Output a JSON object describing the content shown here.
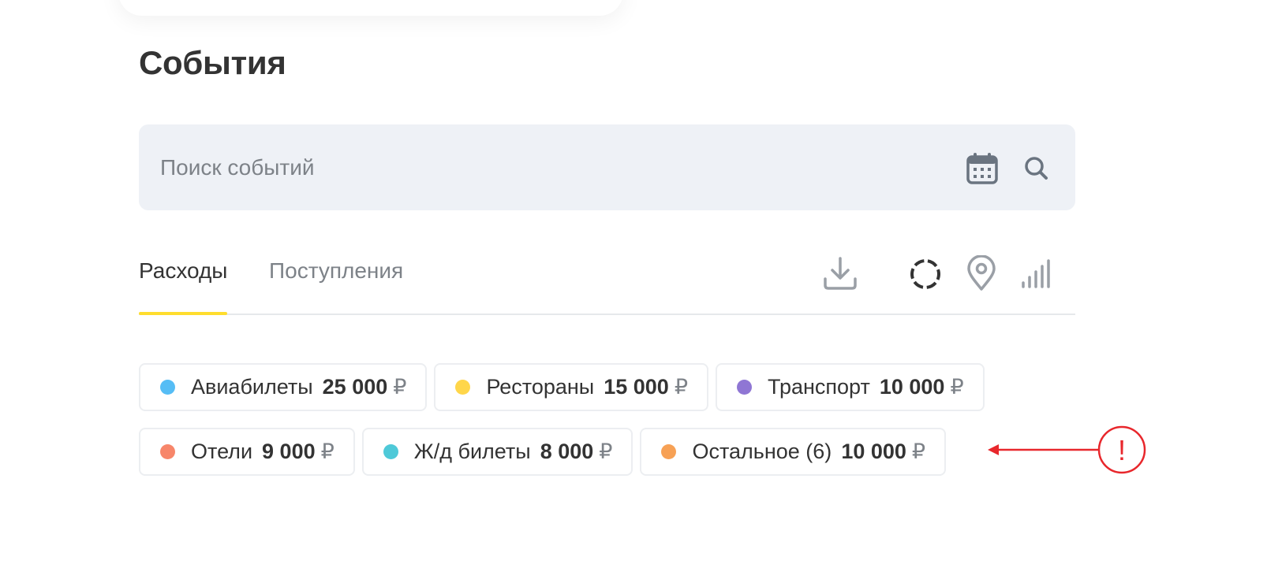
{
  "page": {
    "title": "События"
  },
  "search": {
    "placeholder": "Поиск событий",
    "value": ""
  },
  "icons": {
    "calendar": "calendar-icon",
    "search": "search-icon",
    "download": "download-icon",
    "donut": "donut-chart-icon",
    "map": "map-pin-icon",
    "bars": "bar-chart-icon",
    "annotation": "exclamation-icon"
  },
  "tabs": [
    {
      "label": "Расходы",
      "active": true
    },
    {
      "label": "Поступления",
      "active": false
    }
  ],
  "categories": [
    {
      "label": "Авиабилеты",
      "amount": "25 000",
      "currency": "₽",
      "color": "#56bdf5"
    },
    {
      "label": "Рестораны",
      "amount": "15 000",
      "currency": "₽",
      "color": "#ffd64a"
    },
    {
      "label": "Транспорт",
      "amount": "10 000",
      "currency": "₽",
      "color": "#8f76d4"
    },
    {
      "label": "Отели",
      "amount": "9 000",
      "currency": "₽",
      "color": "#f7866a"
    },
    {
      "label": "Ж/д билеты",
      "amount": "8 000",
      "currency": "₽",
      "color": "#4ec9d8"
    },
    {
      "label": "Остальное (6)",
      "amount": "10 000",
      "currency": "₽",
      "color": "#f7a155"
    }
  ],
  "annotation": {
    "symbol": "!",
    "color": "#e8272c"
  },
  "colors": {
    "accent": "#ffdd2d",
    "search_bg": "#eef1f6",
    "muted_text": "#7d8288"
  }
}
